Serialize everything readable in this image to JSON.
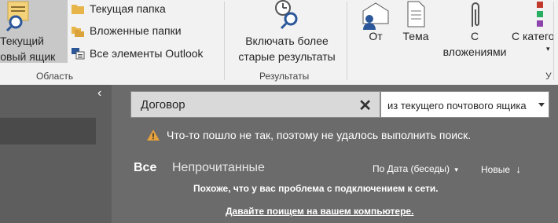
{
  "ribbon": {
    "current_mailbox_label_line1": "Текущий",
    "current_mailbox_label_line2": "товый ящик",
    "scope_options": [
      "Текущая папка",
      "Вложенные папки",
      "Все элементы Outlook"
    ],
    "scope_group_label": "Область",
    "include_older_line1": "Включать более",
    "include_older_line2": "старые результаты",
    "results_group_label": "Результаты",
    "refine": {
      "from": "От",
      "subject": "Тема",
      "attachments_line1": "С",
      "attachments_line2": "вложениями",
      "categories": "С катего",
      "trailing_group_initial": "У"
    }
  },
  "search": {
    "query": "Договор",
    "clear_icon": "✕",
    "scope": "из текущего почтового ящика"
  },
  "warning_text": "Что-то пошло не так, поэтому не удалось выполнить поиск.",
  "tabs": {
    "all": "Все",
    "unread": "Непрочитанные"
  },
  "sort": {
    "by": "По Дата (беседы)",
    "order": "Новые"
  },
  "messages": {
    "network": "Похоже, что у вас проблема с подключением к сети.",
    "search_local": "Давайте поищем на вашем компьютере."
  },
  "colors": {
    "ribbon_bg": "#f2f2f2",
    "pane_bg": "#6b6b6b",
    "warning": "#e6a23c",
    "icon_blue": "#2b579a"
  }
}
